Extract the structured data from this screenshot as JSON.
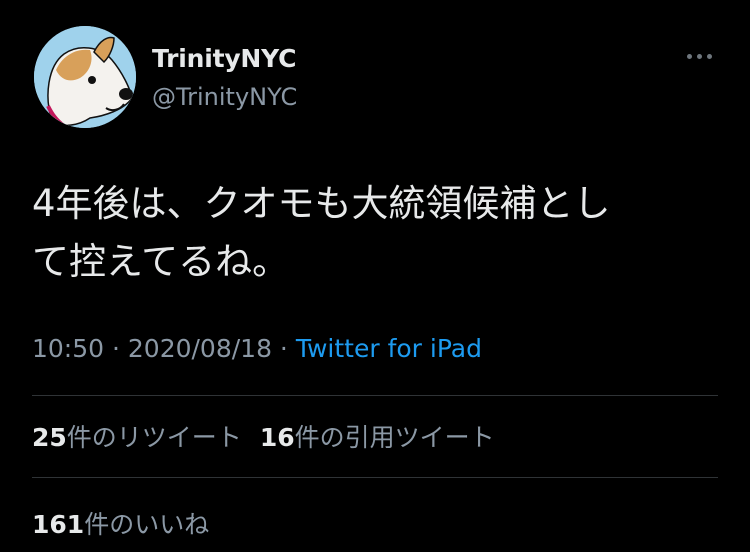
{
  "author": {
    "display_name": "TrinityNYC",
    "handle": "@TrinityNYC",
    "avatar_icon": "dog-avatar"
  },
  "tweet": {
    "text": "4年後は、クオモも大統領候補とし\nて控えてるね。",
    "time": "10:50",
    "date": "2020/08/18",
    "separator": " · ",
    "source": "Twitter for iPad"
  },
  "stats": {
    "retweets_count": "25",
    "retweets_label": "件のリツイート",
    "quotes_count": "16",
    "quotes_label": "件の引用ツイート",
    "likes_count": "161",
    "likes_label": "件のいいね"
  },
  "colors": {
    "background": "#000000",
    "text_primary": "#e7e9ea",
    "text_secondary": "#8b98a5",
    "link": "#1d9bf0",
    "divider": "#2f3336"
  }
}
